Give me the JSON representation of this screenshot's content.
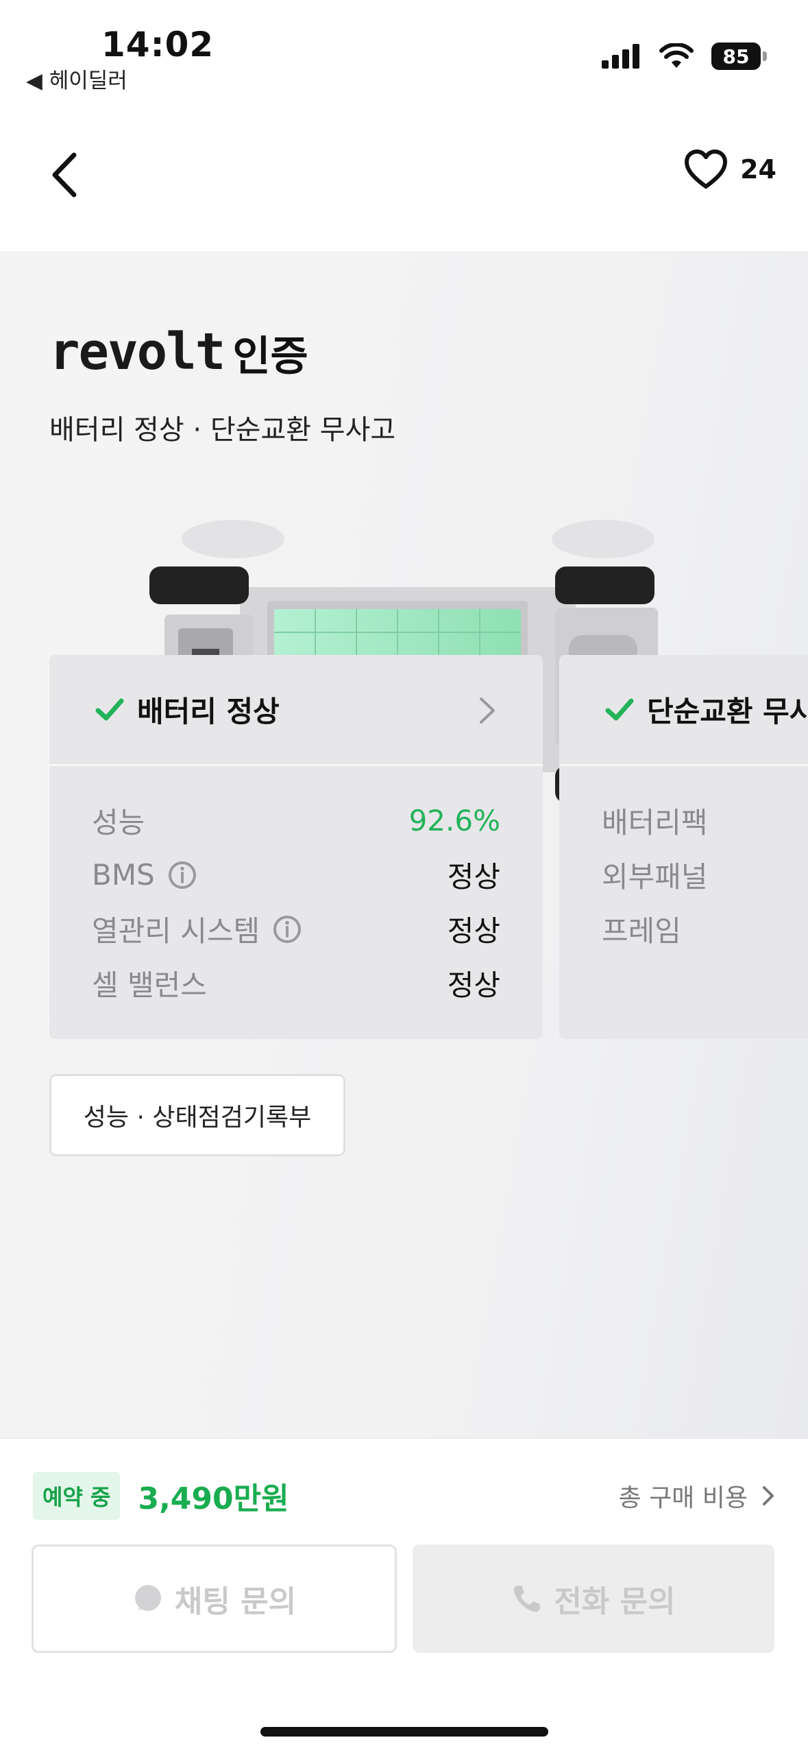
{
  "status_bar": {
    "time": "14:02",
    "back_app": "◀ 헤이딜러",
    "battery": "85",
    "icons": [
      "cellular-signal-icon",
      "wifi-icon",
      "battery-icon"
    ]
  },
  "nav": {
    "back_icon": "chevron-left-icon",
    "like_icon": "heart-icon",
    "like_count": "24"
  },
  "hero": {
    "brand_logo": "revolt",
    "brand_suffix": "인증",
    "subtitle": "배터리 정상 · 단순교환 무사고"
  },
  "cards": [
    {
      "title": "배터리 정상",
      "rows": [
        {
          "label": "성능",
          "value": "92.6%",
          "info": false,
          "highlight": true
        },
        {
          "label": "BMS",
          "value": "정상",
          "info": true
        },
        {
          "label": "열관리 시스템",
          "value": "정상",
          "info": true
        },
        {
          "label": "셀 밸런스",
          "value": "정상",
          "info": false
        }
      ]
    },
    {
      "title": "단순교환 무사고",
      "rows": [
        {
          "label": "배터리팩"
        },
        {
          "label": "외부패널"
        },
        {
          "label": "프레임"
        }
      ]
    }
  ],
  "record_button": "성능 · 상태점검기록부",
  "bottom": {
    "badge": "예약 중",
    "price": "3,490만원",
    "total_cost": "총 구매 비용",
    "chat_button": "채팅 문의",
    "call_button": "전화 문의"
  },
  "colors": {
    "accent_green": "#22b35a",
    "badge_bg": "#e4f5ea",
    "battery_cell": "#9fe6bf"
  }
}
